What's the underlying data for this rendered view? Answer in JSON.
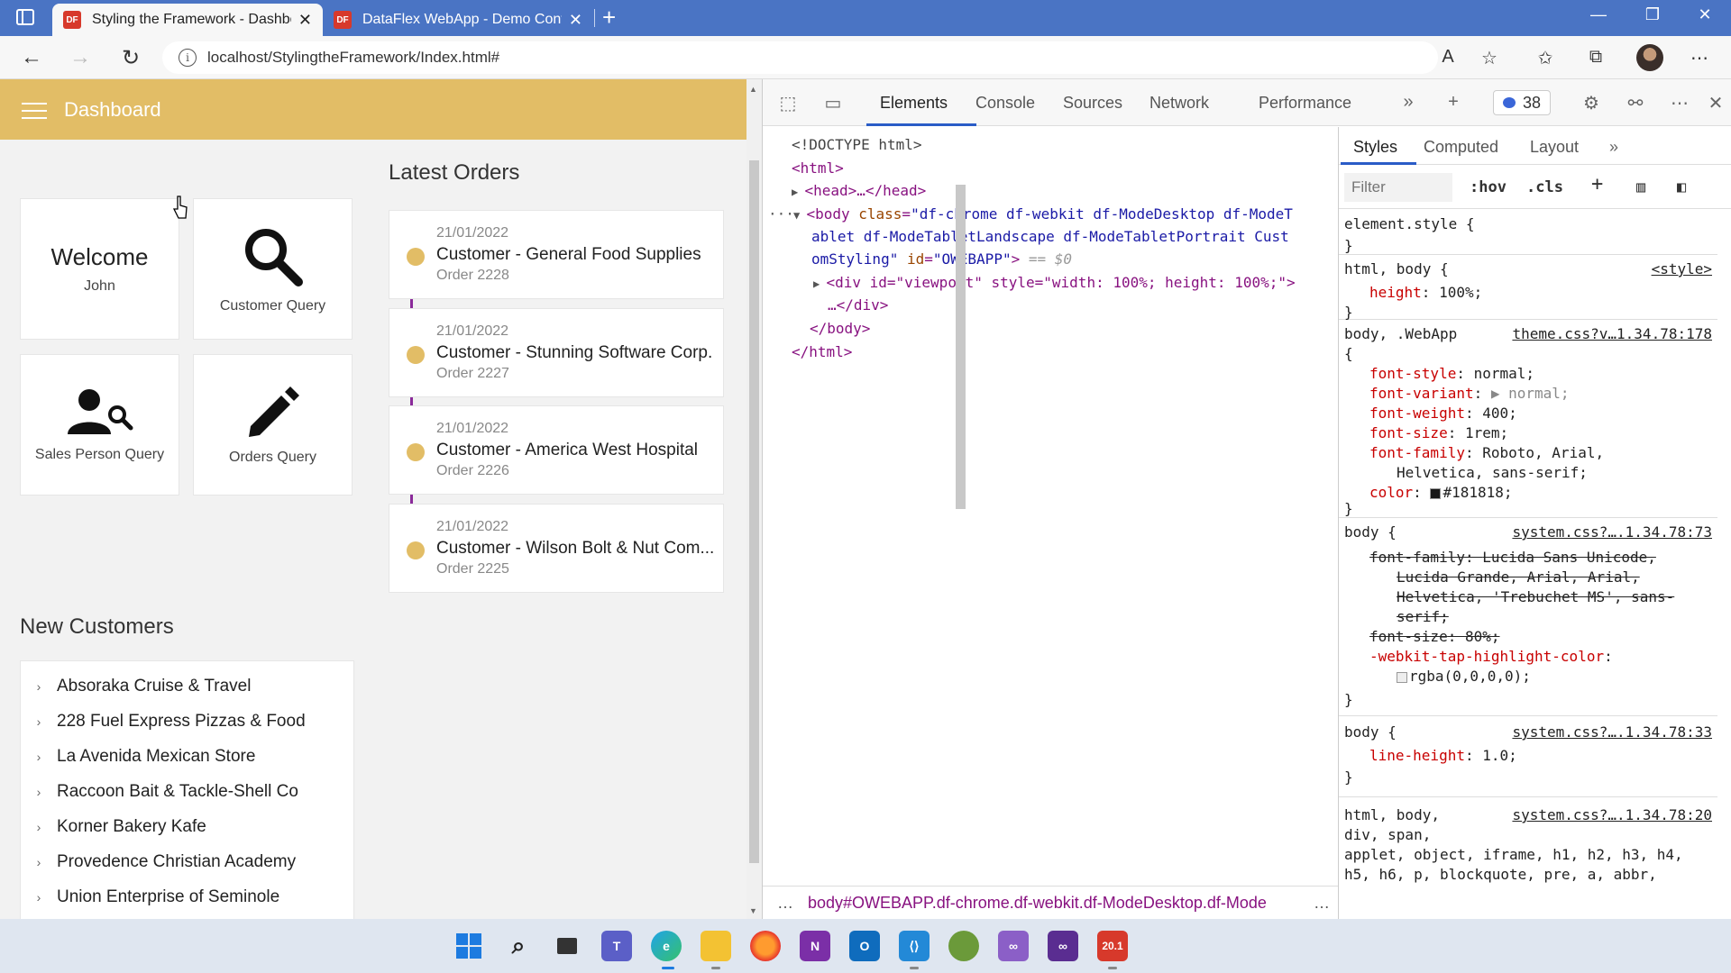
{
  "browser": {
    "tabs": [
      {
        "title": "Styling the Framework - Dashboard",
        "active": true
      },
      {
        "title": "DataFlex WebApp - Demo Contr",
        "active": false
      }
    ],
    "logo_text": "DF",
    "url": "localhost/StylingtheFramework/Index.html#",
    "icons": [
      "back-icon",
      "forward-icon",
      "refresh-icon",
      "info-icon",
      "read-aloud-icon",
      "favorite-add-icon",
      "favorites-icon",
      "collections-icon",
      "profile-avatar",
      "more-icon"
    ]
  },
  "app": {
    "title": "Dashboard",
    "colors": {
      "header": "#e2bd66",
      "timeline_line": "#8a2a9a",
      "timeline_dot": "#e2bd66"
    },
    "welcome": {
      "title": "Welcome",
      "name": "John"
    },
    "tiles": [
      {
        "label": "Customer Query",
        "icon": "search-icon"
      },
      {
        "label": "Sales Person Query",
        "icon": "person-search-icon"
      },
      {
        "label": "Orders Query",
        "icon": "pencil-icon"
      }
    ],
    "latest_orders_title": "Latest Orders",
    "orders": [
      {
        "date": "21/01/2022",
        "customer": "Customer - General Food Supplies",
        "order": "Order 2228"
      },
      {
        "date": "21/01/2022",
        "customer": "Customer - Stunning Software Corp.",
        "order": "Order 2227"
      },
      {
        "date": "21/01/2022",
        "customer": "Customer - America West Hospital",
        "order": "Order 2226"
      },
      {
        "date": "21/01/2022",
        "customer": "Customer - Wilson Bolt & Nut Com...",
        "order": "Order 2225"
      }
    ],
    "new_customers_title": "New Customers",
    "customers": [
      "Absoraka Cruise & Travel",
      "228 Fuel Express Pizzas & Food",
      "La Avenida Mexican Store",
      "Raccoon Bait & Tackle-Shell Co",
      "Korner Bakery Kafe",
      "Provedence Christian Academy",
      "Union Enterprise of Seminole"
    ]
  },
  "devtools": {
    "tabs": [
      "Elements",
      "Console",
      "Sources",
      "Network",
      "Performance"
    ],
    "active_tab": "Elements",
    "issues_count": "38",
    "dom": {
      "doctype": "<!DOCTYPE html>",
      "html_open": "<html>",
      "head": "<head>…</head>",
      "body_class_1": "df-chrome df-webkit df-ModeDesktop df-ModeT",
      "body_class_2": "ablet df-ModeTabletLandscape df-ModeTabletPortrait  Cust",
      "body_class_3": "omStyling",
      "body_id": "OWEBAPP",
      "selected_marker": "== $0",
      "viewport_open": "<div id=\"viewport\" style=\"width: 100%; height: 100%;\">",
      "viewport_close": "…</div>",
      "body_close": "</body>",
      "html_close": "</html>"
    },
    "breadcrumb": "body#OWEBAPP.df-chrome.df-webkit.df-ModeDesktop.df-Mode",
    "styles": {
      "tabs": [
        "Styles",
        "Computed",
        "Layout"
      ],
      "active_tab": "Styles",
      "filter_placeholder": "Filter",
      "hov": ":hov",
      "cls": ".cls",
      "rules": [
        {
          "selector": "element.style {",
          "source": "",
          "lines": []
        },
        {
          "selector": "html, body {",
          "source": "<style>",
          "lines": [
            {
              "prop": "height",
              "value": "100%;"
            }
          ]
        },
        {
          "selector": "body, .WebApp",
          "source": "theme.css?v…1.34.78:178",
          "lines": [
            {
              "prop": "font-style",
              "value": "normal;"
            },
            {
              "prop": "font-variant",
              "value": "▶ normal;"
            },
            {
              "prop": "font-weight",
              "value": "400;"
            },
            {
              "prop": "font-size",
              "value": "1rem;"
            },
            {
              "prop": "font-family",
              "value": "Roboto, Arial,"
            },
            {
              "prop": "",
              "value": "Helvetica, sans-serif;"
            },
            {
              "prop": "color",
              "value": "#181818;"
            }
          ]
        },
        {
          "selector": "body {",
          "source": "system.css?….1.34.78:73",
          "lines": [
            {
              "prop": "font-family",
              "value": "Lucida Sans Unicode,",
              "struck": true
            },
            {
              "prop": "",
              "value": "Lucida Grande, Arial, Arial,",
              "struck": true
            },
            {
              "prop": "",
              "value": "Helvetica, 'Trebuchet MS', sans-",
              "struck": true
            },
            {
              "prop": "",
              "value": "serif;",
              "struck": true
            },
            {
              "prop": "font-size",
              "value": "80%;",
              "struck": true
            },
            {
              "prop": "-webkit-tap-highlight-color",
              "value": ""
            },
            {
              "prop": "",
              "value": "rgba(0,0,0,0);"
            }
          ]
        },
        {
          "selector": "body {",
          "source": "system.css?….1.34.78:33",
          "lines": [
            {
              "prop": "line-height",
              "value": "1.0;"
            }
          ]
        },
        {
          "selector": "html, body,",
          "source": "system.css?….1.34.78:20",
          "lines": [
            {
              "prop": "",
              "value": "div, span,"
            },
            {
              "prop": "",
              "value": "applet, object, iframe, h1, h2, h3, h4,"
            },
            {
              "prop": "",
              "value": "h5, h6, p, blockquote, pre, a, abbr,"
            }
          ]
        }
      ]
    }
  },
  "taskbar": {
    "apps": [
      "windows-start-icon",
      "search-icon",
      "task-view-icon",
      "teams-icon",
      "edge-icon",
      "file-explorer-icon",
      "firefox-icon",
      "onenote-icon",
      "outlook-icon",
      "vscode-icon",
      "xbox-icon",
      "visual-studio-icon",
      "visual-studio-preview-icon",
      "dataflex-icon"
    ],
    "dataflex_label": "20.1"
  }
}
